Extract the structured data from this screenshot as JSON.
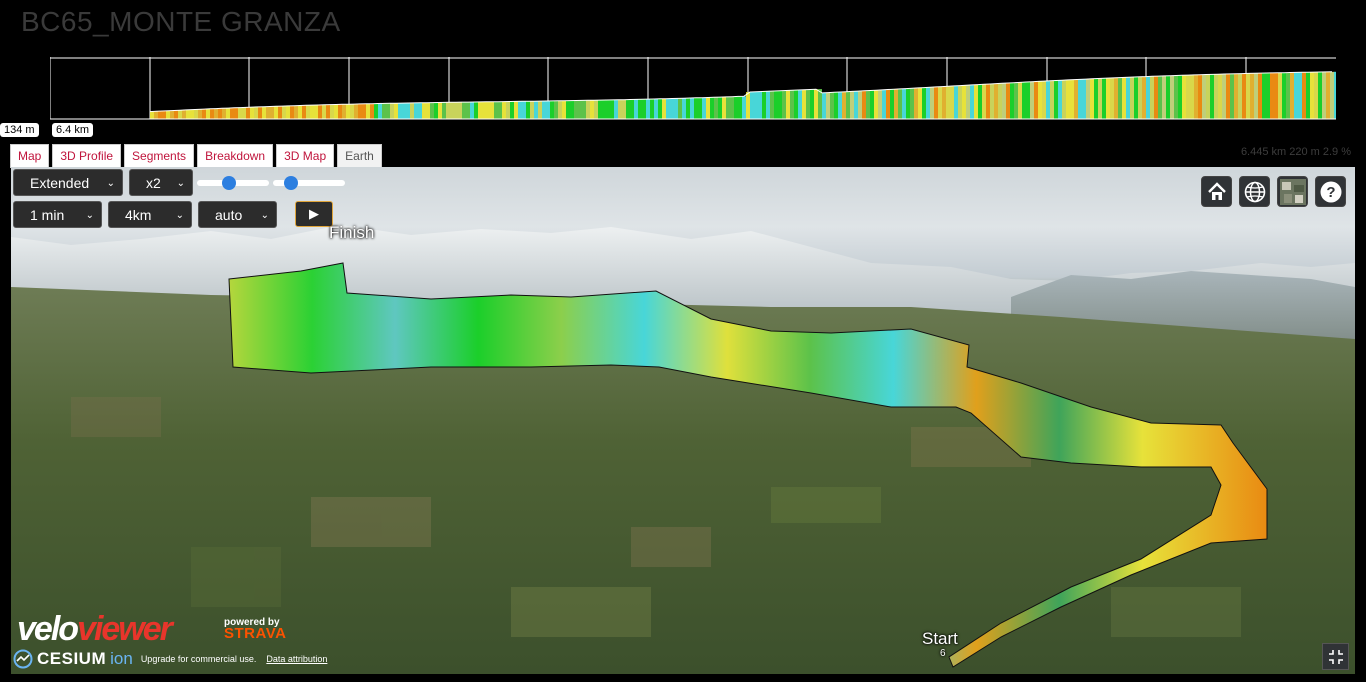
{
  "page": {
    "title": "BC65_MONTE GRANZA"
  },
  "profile_chips": {
    "elevation": "134 m",
    "distance": "6.4 km"
  },
  "tabs": [
    {
      "label": "Map",
      "active": false
    },
    {
      "label": "3D Profile",
      "active": false
    },
    {
      "label": "Segments",
      "active": false
    },
    {
      "label": "Breakdown",
      "active": false
    },
    {
      "label": "3D Map",
      "active": false
    },
    {
      "label": "Earth",
      "active": true
    }
  ],
  "stats": "6.445 km 220 m 2.9 %",
  "controls": {
    "view_mode": "Extended",
    "exaggeration": "x2",
    "time_step": "1 min",
    "distance_step": "4km",
    "camera": "auto",
    "play_icon": "play-icon",
    "slider1_value": 0.45,
    "slider2_value": 0.25
  },
  "toolbar": {
    "home_icon": "home-icon",
    "globe_icon": "globe-icon",
    "imagery_icon": "imagery-icon",
    "help_icon": "help-icon"
  },
  "map_labels": {
    "finish": "Finish",
    "start": "Start",
    "start_marker": "6"
  },
  "branding": {
    "logo_a": "velo",
    "logo_b": "viewer",
    "powered_by": "powered by",
    "strava": "STRAVA",
    "cesium": "CESIUM",
    "ion": "ion",
    "upgrade_note": "Upgrade for commercial use.",
    "data_attribution": "Data attribution"
  },
  "colors": {
    "tab_text": "#c0143c",
    "gradient_yellow": "#e7e23a",
    "gradient_green": "#1bcf2a",
    "gradient_cyan": "#48d6d8",
    "gradient_orange": "#e98a12",
    "gradient_red": "#e8352b"
  }
}
